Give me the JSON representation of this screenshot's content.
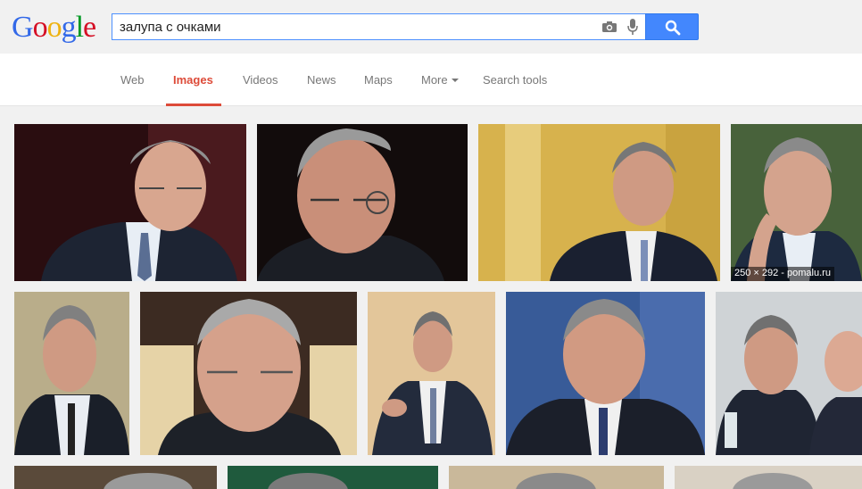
{
  "logo": {
    "letters": [
      "G",
      "o",
      "o",
      "g",
      "l",
      "e"
    ],
    "colors": [
      "#3369e8",
      "#d50f25",
      "#eeb211",
      "#3369e8",
      "#009925",
      "#d50f25"
    ]
  },
  "search": {
    "query": "залупа с очками"
  },
  "nav": {
    "web": "Web",
    "images": "Images",
    "videos": "Videos",
    "news": "News",
    "maps": "Maps",
    "more": "More",
    "search_tools": "Search tools"
  },
  "colors": {
    "accent_red": "#dd4b39",
    "search_blue": "#4387fd"
  },
  "results": {
    "hover_caption": "250 × 292 - pomalu.ru"
  }
}
